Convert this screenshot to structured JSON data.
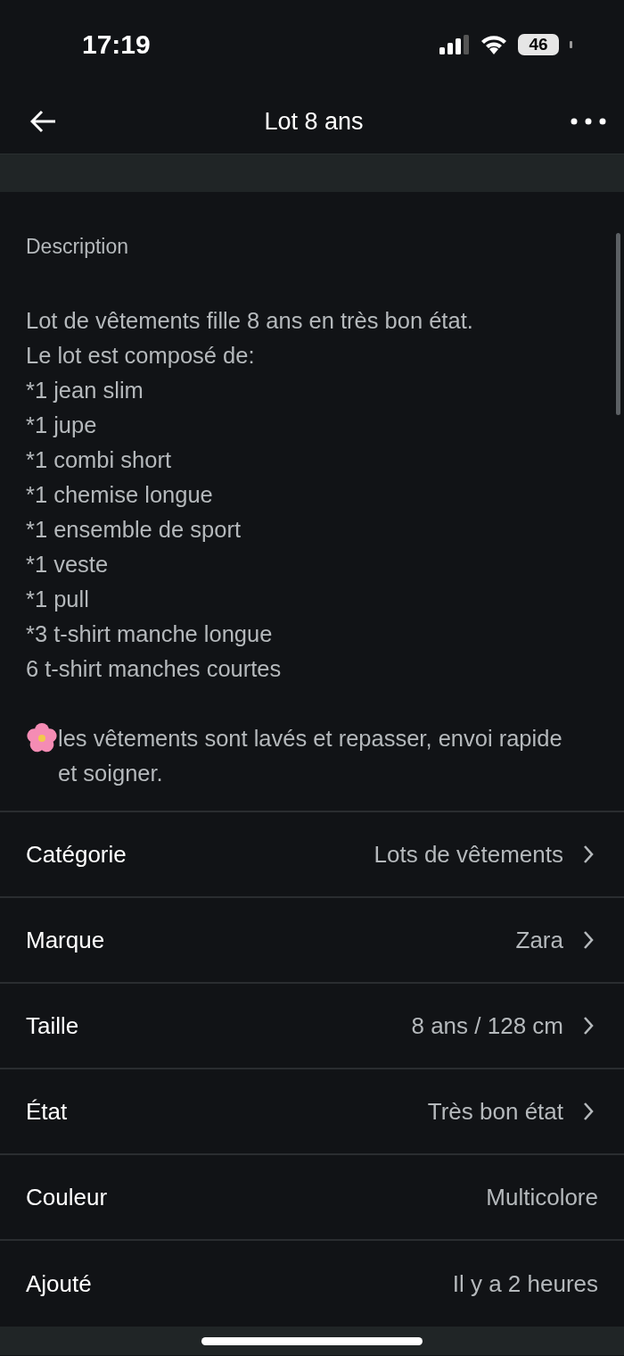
{
  "status_bar": {
    "time": "17:19",
    "battery": "46"
  },
  "nav": {
    "title": "Lot 8 ans"
  },
  "description": {
    "heading": "Description",
    "text": "Lot de vêtements fille 8 ans en très bon état.\nLe lot est composé de:\n*1 jean slim\n*1 jupe\n*1 combi short\n*1 chemise longue\n*1 ensemble de sport\n*1 veste\n*1 pull\n*3 t-shirt manche longue\n6 t-shirt manches courtes",
    "note": "les vêtements sont lavés et repasser, envoi rapide et soigner."
  },
  "details": [
    {
      "label": "Catégorie",
      "value": "Lots de vêtements",
      "link": true
    },
    {
      "label": "Marque",
      "value": "Zara",
      "link": true
    },
    {
      "label": "Taille",
      "value": "8 ans / 128 cm",
      "link": true
    },
    {
      "label": "État",
      "value": "Très bon état",
      "link": true
    },
    {
      "label": "Couleur",
      "value": "Multicolore",
      "link": false
    },
    {
      "label": "Ajouté",
      "value": "Il y a 2 heures",
      "link": false
    }
  ]
}
